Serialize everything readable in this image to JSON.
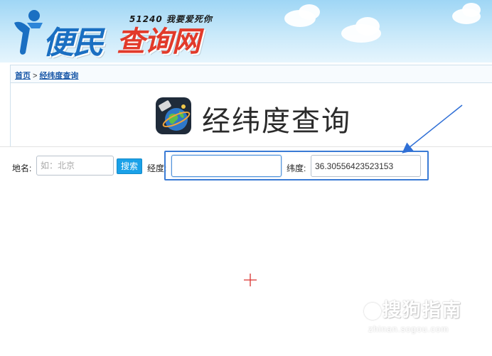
{
  "header": {
    "logo_main": "便民",
    "logo_red": "查询网",
    "slogan": "51240 我要爱死你"
  },
  "breadcrumb": {
    "home": "首页",
    "separator": ">",
    "current": "经纬度查询"
  },
  "page": {
    "title": "经纬度查询"
  },
  "search": {
    "place_label": "地名:",
    "place_placeholder": "如：北京",
    "search_button": "搜索",
    "longitude_label": "经度:",
    "longitude_value": "",
    "latitude_label": "纬度:",
    "latitude_value": "36.30556423523153"
  },
  "watermark": {
    "main": "搜狗指南",
    "sub": "zhinan.sogou.com"
  },
  "colors": {
    "accent": "#1aa1e8",
    "highlight": "#3a7bd5",
    "logo_blue": "#1a6fc2",
    "logo_red": "#e23a2a",
    "crosshair": "#d9322f"
  }
}
